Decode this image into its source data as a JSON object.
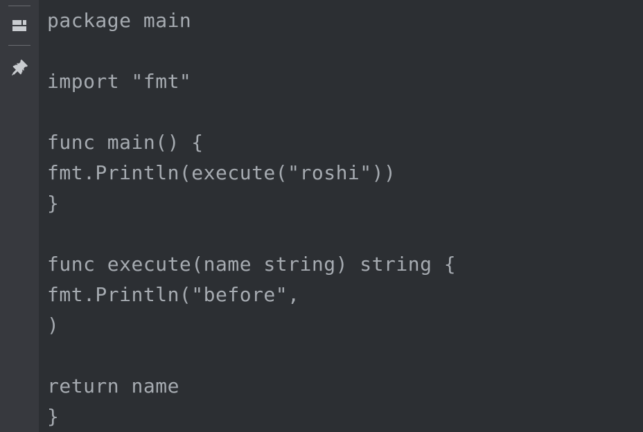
{
  "code": {
    "lines": [
      "package main",
      "",
      "import \"fmt\"",
      "",
      "func main() {",
      "fmt.Println(execute(\"roshi\"))",
      "}",
      "",
      "func execute(name string) string {",
      "fmt.Println(\"before\",",
      ")",
      "",
      "return name",
      "}"
    ]
  }
}
